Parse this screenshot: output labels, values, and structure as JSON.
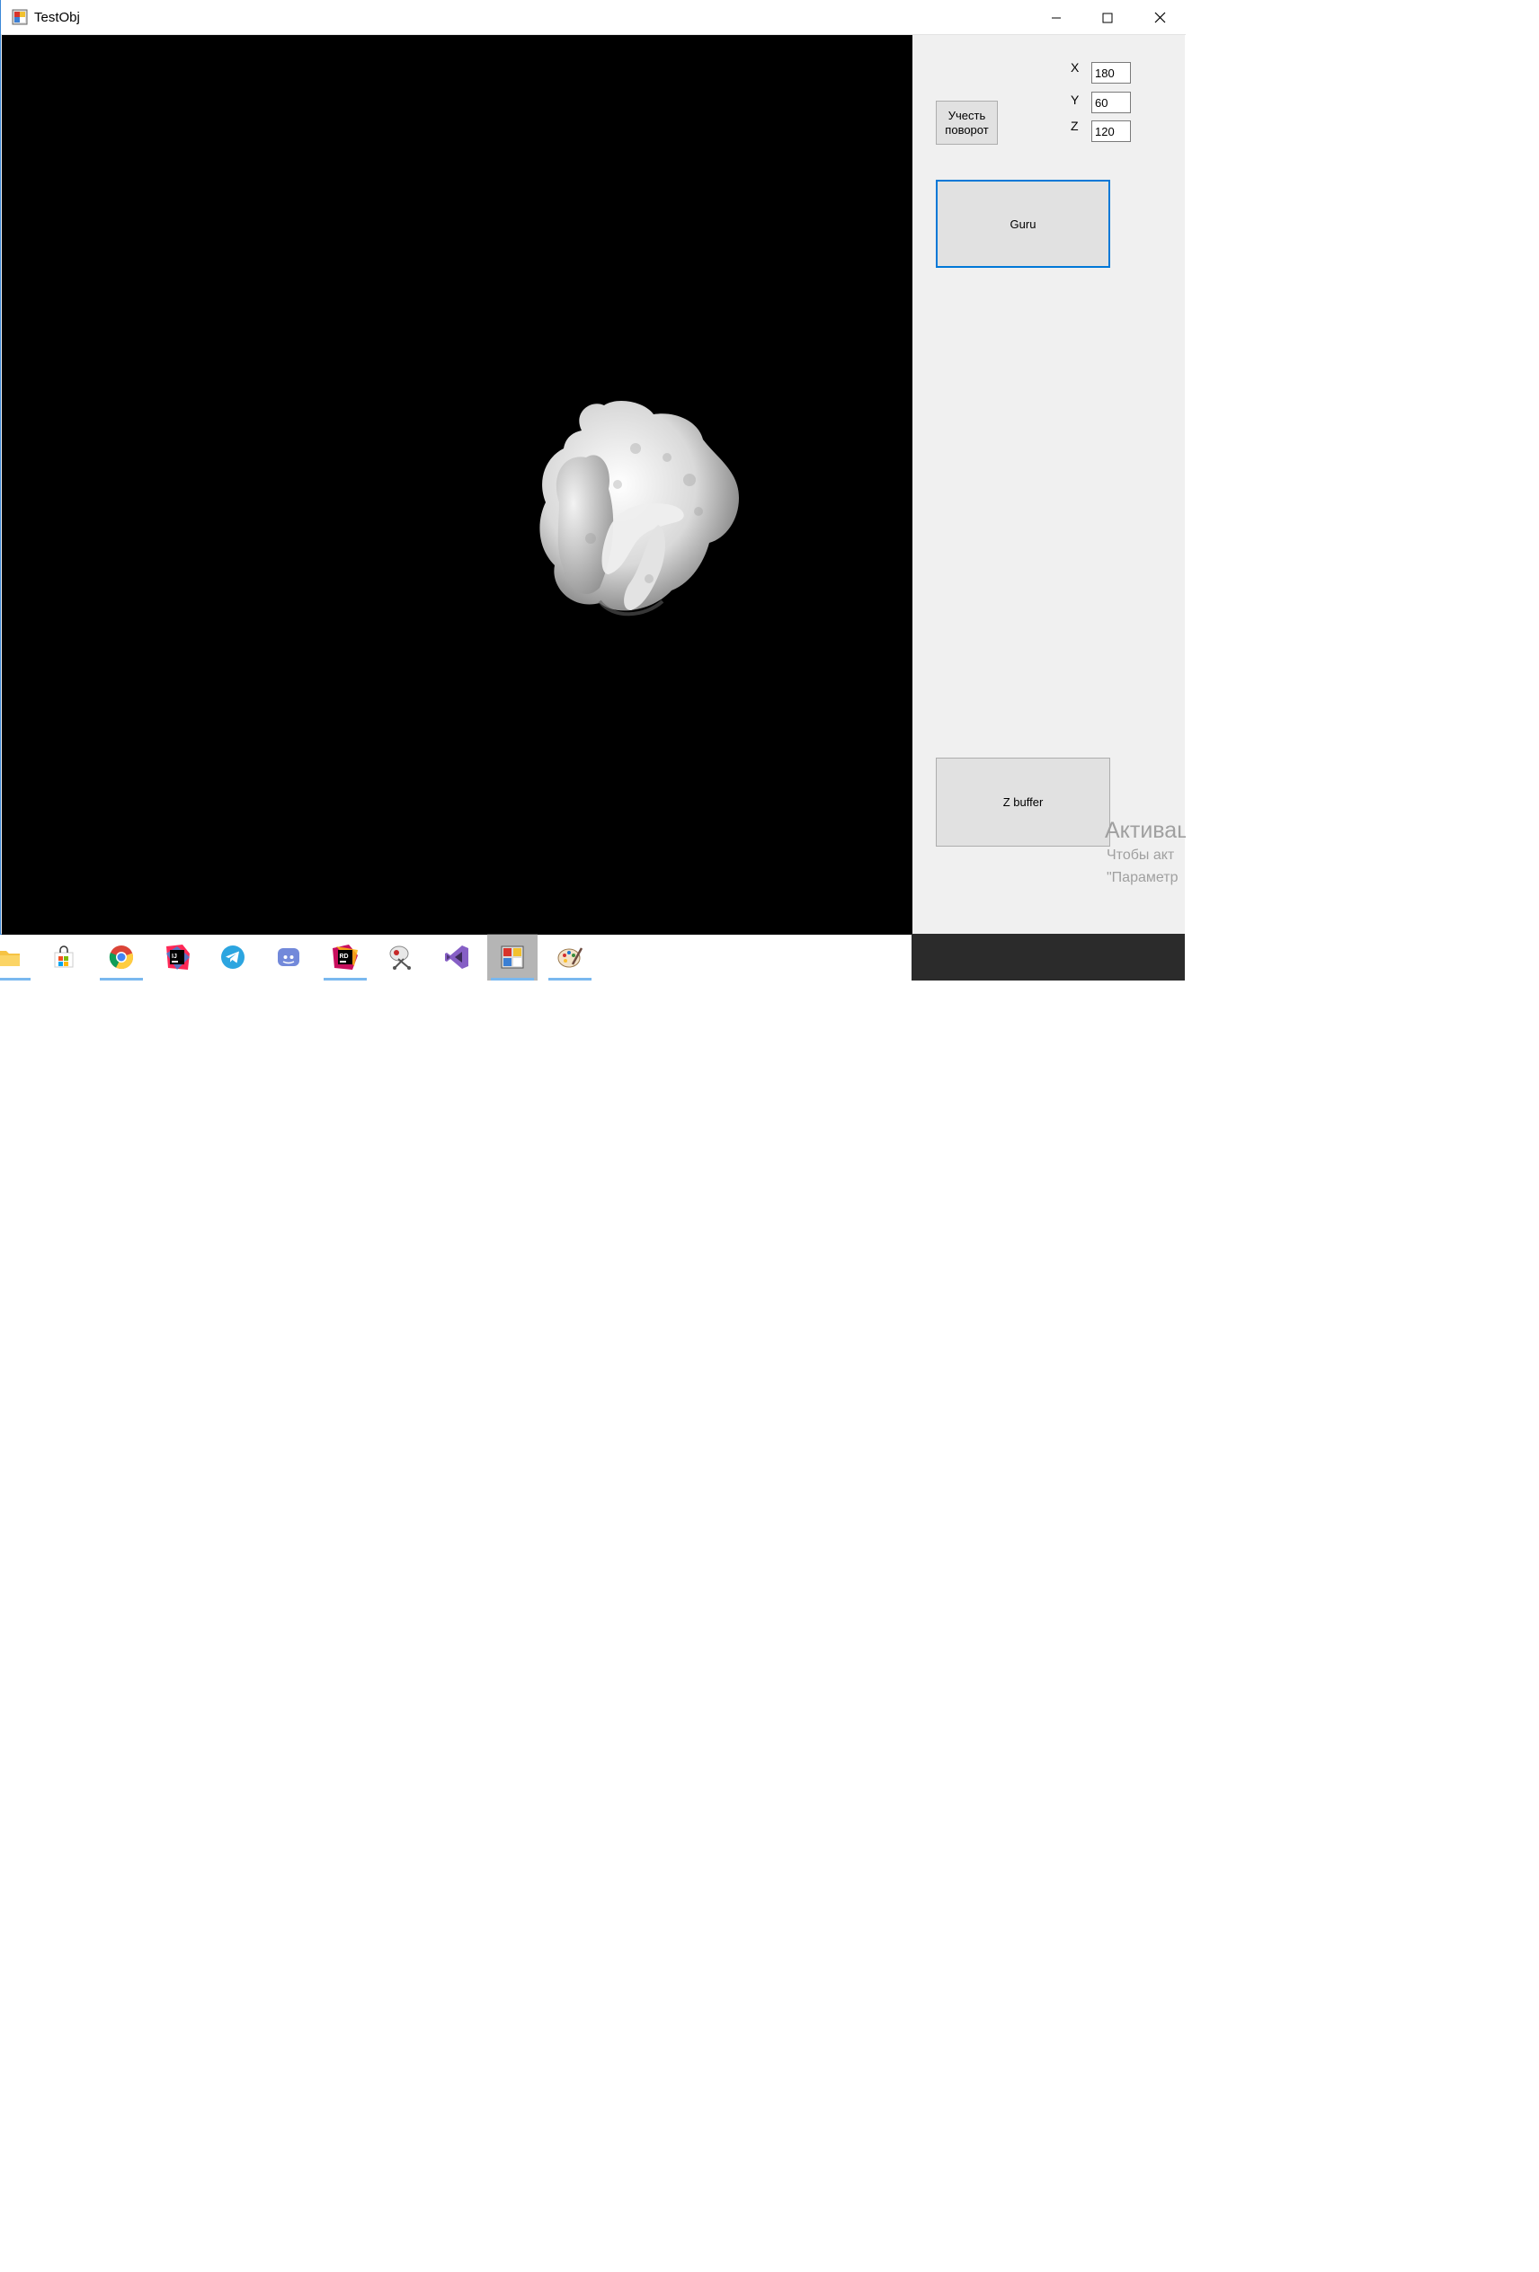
{
  "window": {
    "title": "TestObj",
    "controls": {
      "minimize": "minimize-icon",
      "maximize": "maximize-icon",
      "close": "close-icon"
    }
  },
  "panel": {
    "rotate_button": "Учесть поворот",
    "rotation": {
      "x_label": "X",
      "x_value": "180",
      "y_label": "Y",
      "y_value": "60",
      "z_label": "Z",
      "z_value": "120"
    },
    "guru_button": "Guru",
    "zbuffer_button": "Z buffer"
  },
  "activation_watermark": {
    "title": "Активац",
    "line1": "Чтобы акт",
    "line2": "\"Параметр"
  },
  "taskbar": {
    "items": [
      {
        "icon": "file-explorer-icon",
        "active": false,
        "running": true
      },
      {
        "icon": "store-icon",
        "active": false,
        "running": false
      },
      {
        "icon": "chrome-icon",
        "active": false,
        "running": true
      },
      {
        "icon": "intellij-icon",
        "active": false,
        "running": false
      },
      {
        "icon": "telegram-icon",
        "active": false,
        "running": false
      },
      {
        "icon": "discord-icon",
        "active": false,
        "running": false
      },
      {
        "icon": "rider-icon",
        "active": false,
        "running": true
      },
      {
        "icon": "snipping-tool-icon",
        "active": false,
        "running": false
      },
      {
        "icon": "visual-studio-icon",
        "active": false,
        "running": false
      },
      {
        "icon": "testobj-app-icon",
        "active": true,
        "running": true
      },
      {
        "icon": "paint-icon",
        "active": false,
        "running": true
      }
    ]
  },
  "colors": {
    "viewport_background": "#000000",
    "panel_background": "#f0f0f0",
    "focus_border": "#0078d7",
    "taskbar": "#2b2b2b"
  }
}
